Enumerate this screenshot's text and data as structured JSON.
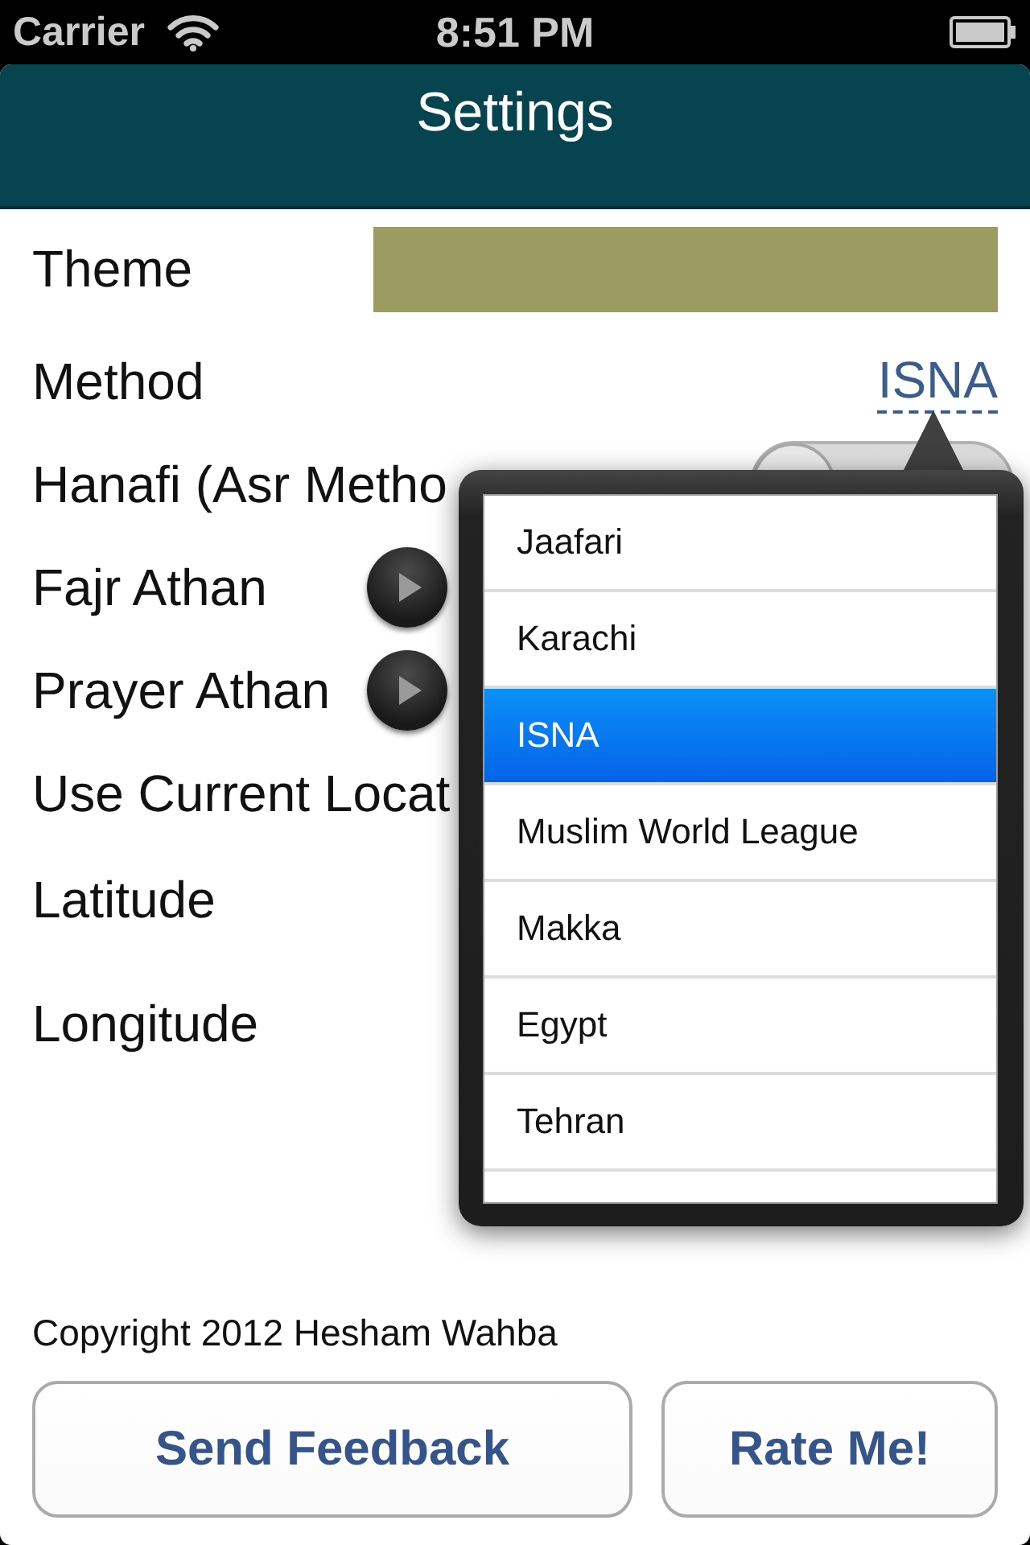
{
  "status_bar": {
    "carrier": "Carrier",
    "time": "8:51 PM"
  },
  "nav_bar": {
    "title": "Settings"
  },
  "settings": [
    {
      "kind": "swatch",
      "label": "Theme",
      "color": "#9a9c62"
    },
    {
      "kind": "link",
      "label": "Method",
      "value": "ISNA"
    },
    {
      "kind": "switch",
      "label": "Hanafi (Asr Metho",
      "on": false
    },
    {
      "kind": "play",
      "label": "Fajr Athan"
    },
    {
      "kind": "play",
      "label": "Prayer Athan"
    },
    {
      "kind": "plain",
      "label": "Use Current Locat"
    },
    {
      "kind": "plain",
      "label": "Latitude"
    },
    {
      "kind": "plain",
      "label": "Longitude"
    }
  ],
  "method_popover": {
    "options": [
      {
        "label": "Jaafari",
        "selected": false
      },
      {
        "label": "Karachi",
        "selected": false
      },
      {
        "label": "ISNA",
        "selected": true
      },
      {
        "label": "Muslim World League",
        "selected": false
      },
      {
        "label": "Makka",
        "selected": false
      },
      {
        "label": "Egypt",
        "selected": false
      },
      {
        "label": "Tehran",
        "selected": false
      }
    ]
  },
  "footer": {
    "copyright": "Copyright 2012 Hesham Wahba",
    "buttons": [
      "Send Feedback",
      "Rate Me!"
    ]
  }
}
